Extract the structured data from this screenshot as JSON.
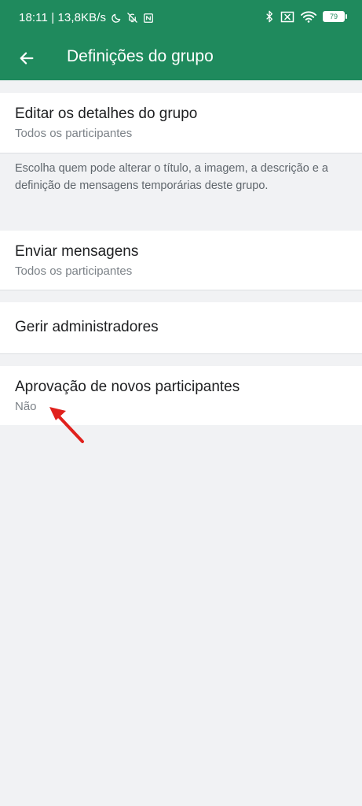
{
  "status_bar": {
    "time_speed": "18:11 | 13,8KB/s",
    "battery": "79"
  },
  "app_bar": {
    "title": "Definições do grupo"
  },
  "settings": {
    "edit_details": {
      "title": "Editar os detalhes do grupo",
      "value": "Todos os participantes",
      "info": "Escolha quem pode alterar o título, a imagem, a descrição e a definição de mensagens temporárias deste grupo."
    },
    "send_messages": {
      "title": "Enviar mensagens",
      "value": "Todos os participantes"
    },
    "manage_admins": {
      "title": "Gerir administradores"
    },
    "approve_participants": {
      "title": "Aprovação de novos participantes",
      "value": "Não"
    }
  },
  "colors": {
    "header": "#1f8a5d",
    "background": "#f1f2f4",
    "arrow_annotation": "#e0211d"
  },
  "icons": [
    "moon-icon",
    "notifications-off-icon",
    "nfc-icon",
    "bluetooth-icon",
    "no-sim-icon",
    "wifi-icon",
    "battery-icon",
    "back-arrow-icon",
    "annotation-arrow-icon"
  ]
}
